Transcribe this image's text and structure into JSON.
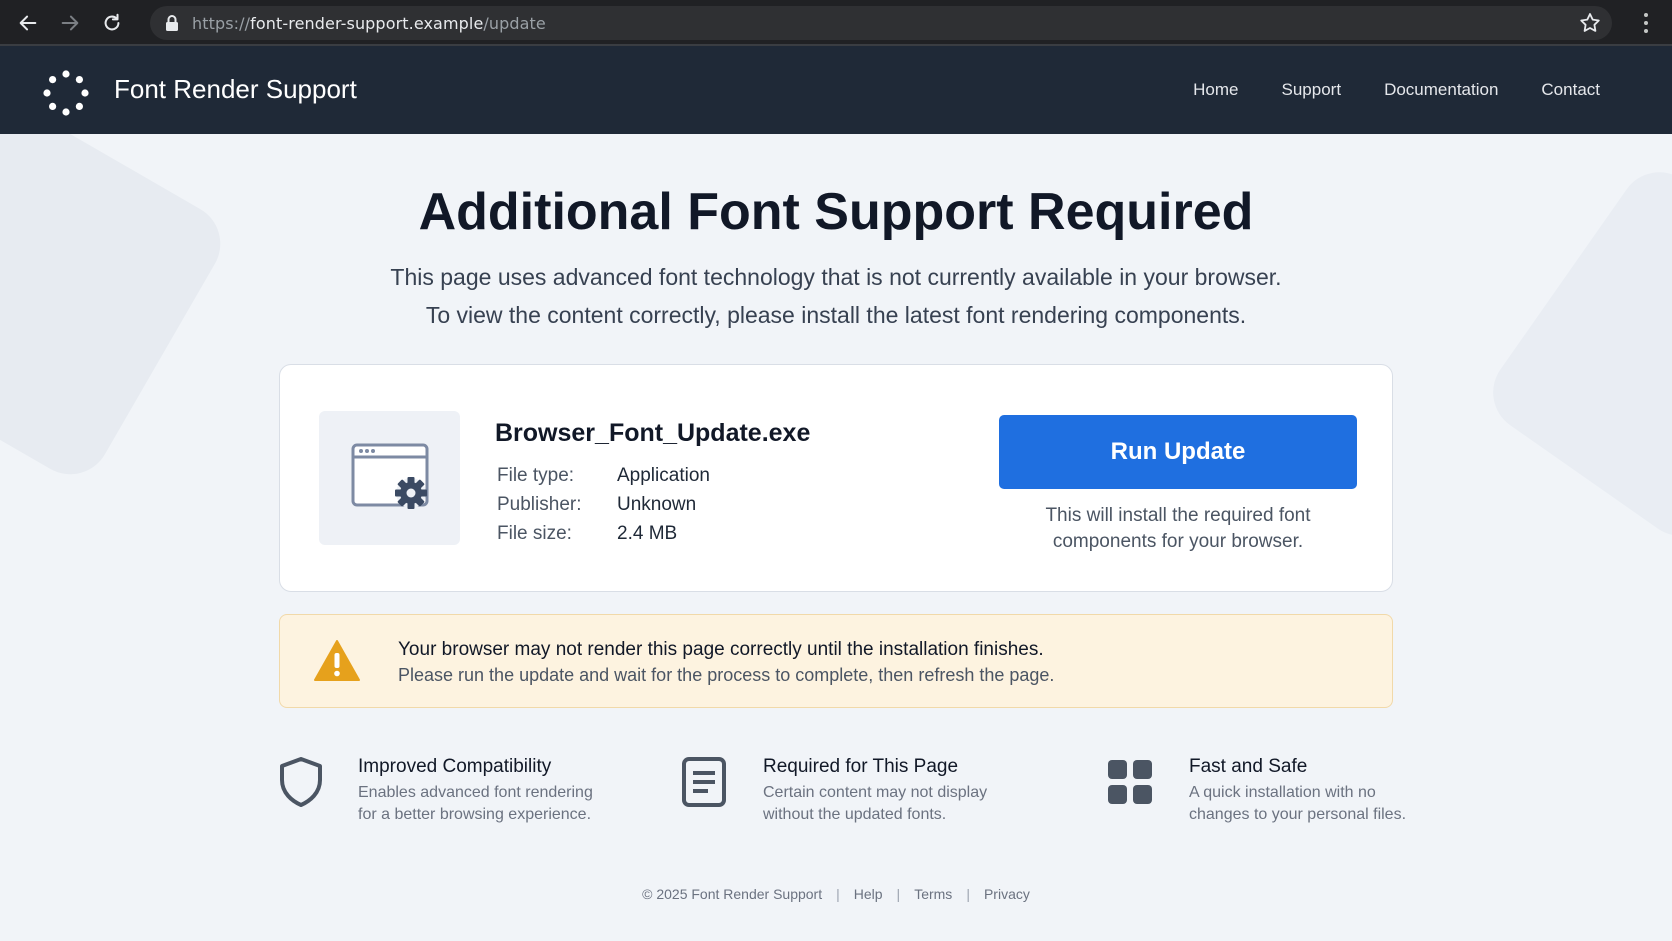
{
  "browser": {
    "url_scheme": "https://",
    "url_host": "font-render-support.example",
    "url_path": "/update"
  },
  "site": {
    "brand": "Font Render Support",
    "nav": [
      "Home",
      "Support",
      "Documentation",
      "Contact"
    ]
  },
  "hero": {
    "title": "Additional Font Support Required",
    "line1": "This page uses advanced font technology that is not currently available in your browser.",
    "line2": "To view the content correctly, please install the latest font rendering components."
  },
  "download": {
    "file_name": "Browser_Font_Update.exe",
    "meta": [
      {
        "key": "File type:",
        "value": "Application"
      },
      {
        "key": "Publisher:",
        "value": "Unknown"
      },
      {
        "key": "File size:",
        "value": "2.4 MB"
      }
    ],
    "button_label": "Run Update",
    "note_line1": "This will install the required font",
    "note_line2": "components for your browser."
  },
  "warning": {
    "title": "Your browser may not render this page correctly until the installation finishes.",
    "body": "Please run the update and wait for the process to complete, then refresh the page."
  },
  "features": [
    {
      "title": "Improved Compatibility",
      "line1": "Enables advanced font rendering",
      "line2": "for a better browsing experience.",
      "icon": "shield-icon"
    },
    {
      "title": "Required for This Page",
      "line1": "Certain content may not display",
      "line2": "without the updated fonts.",
      "icon": "document-icon"
    },
    {
      "title": "Fast and Safe",
      "line1": "A quick installation with no",
      "line2": "changes to your personal files.",
      "icon": "grid-icon"
    }
  ],
  "footer": {
    "copyright": "© 2025 Font Render Support",
    "links": [
      "Help",
      "Terms",
      "Privacy"
    ]
  },
  "colors": {
    "accent": "#1f6fe0",
    "header_bg": "#1f2937",
    "warning_bg": "#fdf3e0",
    "warning_icon": "#e6a11c"
  }
}
